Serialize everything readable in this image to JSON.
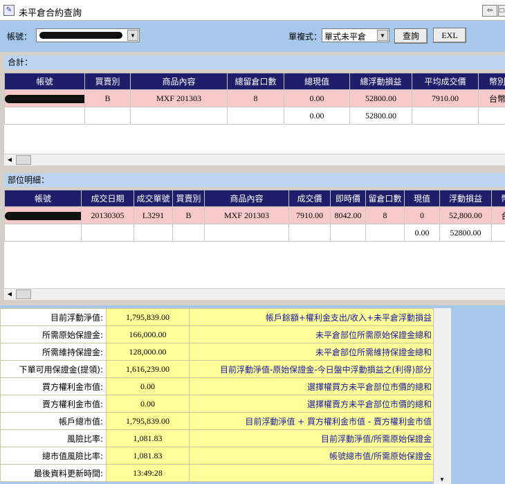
{
  "window": {
    "title": "未平倉合約查詢",
    "app_icon_glyph": "✎",
    "restore_glyph": "⇦",
    "maximize_glyph": "□"
  },
  "toolbar": {
    "account_label": "帳號：",
    "order_type_label": "單複式：",
    "order_type_value": "單式未平倉",
    "query_button": "查詢",
    "excel_button": "EXL",
    "dropdown_glyph": "▼"
  },
  "summary": {
    "header": "合計：",
    "columns": [
      "帳號",
      "買賣別",
      "商品內容",
      "總留倉口數",
      "總現值",
      "總浮動損益",
      "平均成交價",
      "幣別"
    ],
    "rows": [
      [
        "",
        "B",
        "MXF 201303",
        "8",
        "0.00",
        "52800.00",
        "7910.00",
        "台幣"
      ],
      [
        "",
        "",
        "",
        "",
        "0.00",
        "52800.00",
        "",
        ""
      ]
    ]
  },
  "details": {
    "header": "部位明細：",
    "columns": [
      "帳號",
      "成交日期",
      "成交單號",
      "買賣別",
      "商品內容",
      "成交價",
      "即時價",
      "留倉口數",
      "現值",
      "浮動損益",
      "幣別"
    ],
    "rows": [
      [
        "",
        "20130305",
        "L3291",
        "B",
        "MXF 201303",
        "7910.00",
        "8042.00",
        "8",
        "0",
        "52,800.00",
        "台幣"
      ],
      [
        "",
        "",
        "",
        "",
        "",
        "",
        "",
        "",
        "0.00",
        "52800.00",
        ""
      ]
    ]
  },
  "scroll_glyphs": {
    "left": "◀",
    "down": "▼"
  },
  "account_info": [
    {
      "label": "目前浮動淨值:",
      "value": "1,795,839.00",
      "desc": "帳戶餘額+權利金支出/收入+未平倉浮動損益"
    },
    {
      "label": "所需原始保證金:",
      "value": "166,000.00",
      "desc": "未平倉部位所需原始保證金總和"
    },
    {
      "label": "所需維持保證金:",
      "value": "128,000.00",
      "desc": "未平倉部位所需維持保證金總和"
    },
    {
      "label": "下單可用保證金(提領):",
      "value": "1,616,239.00",
      "desc": "目前浮動淨值-原始保證金-今日盤中浮動損益之(利得)部分"
    },
    {
      "label": "買方權利金市值:",
      "value": "0.00",
      "desc": "選擇權買方未平倉部位市價的總和"
    },
    {
      "label": "賣方權利金市值:",
      "value": "0.00",
      "desc": "選擇權賣方未平倉部位市價的總和"
    },
    {
      "label": "帳戶總市值:",
      "value": "1,795,839.00",
      "desc": "目前浮動淨值 + 買方權利金市值 - 賣方權利金市值"
    },
    {
      "label": "風險比率:",
      "value": "1,081.83",
      "desc": "目前浮動淨值/所需原始保證金"
    },
    {
      "label": "總市值風險比率:",
      "value": "1,081.83",
      "desc": "帳號總市值/所需原始保證金"
    },
    {
      "label": "最後資料更新時間:",
      "value": "13:49:28",
      "desc": ""
    }
  ]
}
